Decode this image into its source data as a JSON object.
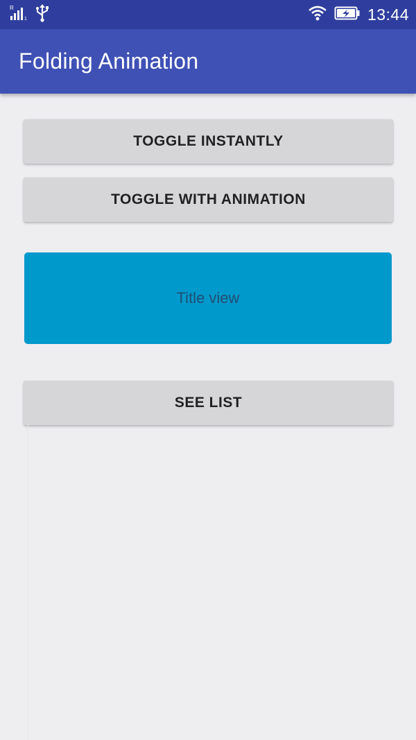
{
  "status_bar": {
    "signal_icon": "signal-roaming-icon",
    "usb_icon": "usb-icon",
    "wifi_icon": "wifi-icon",
    "battery_icon": "battery-charging-icon",
    "time": "13:44",
    "background_color": "#2f3e9e"
  },
  "app_bar": {
    "title": "Folding Animation",
    "background_color": "#3f51b5"
  },
  "buttons": {
    "toggle_instantly": "TOGGLE INSTANTLY",
    "toggle_with_animation": "TOGGLE WITH ANIMATION",
    "see_list": "SEE LIST"
  },
  "title_view": {
    "label": "Title view",
    "background_color": "#0099cc"
  }
}
